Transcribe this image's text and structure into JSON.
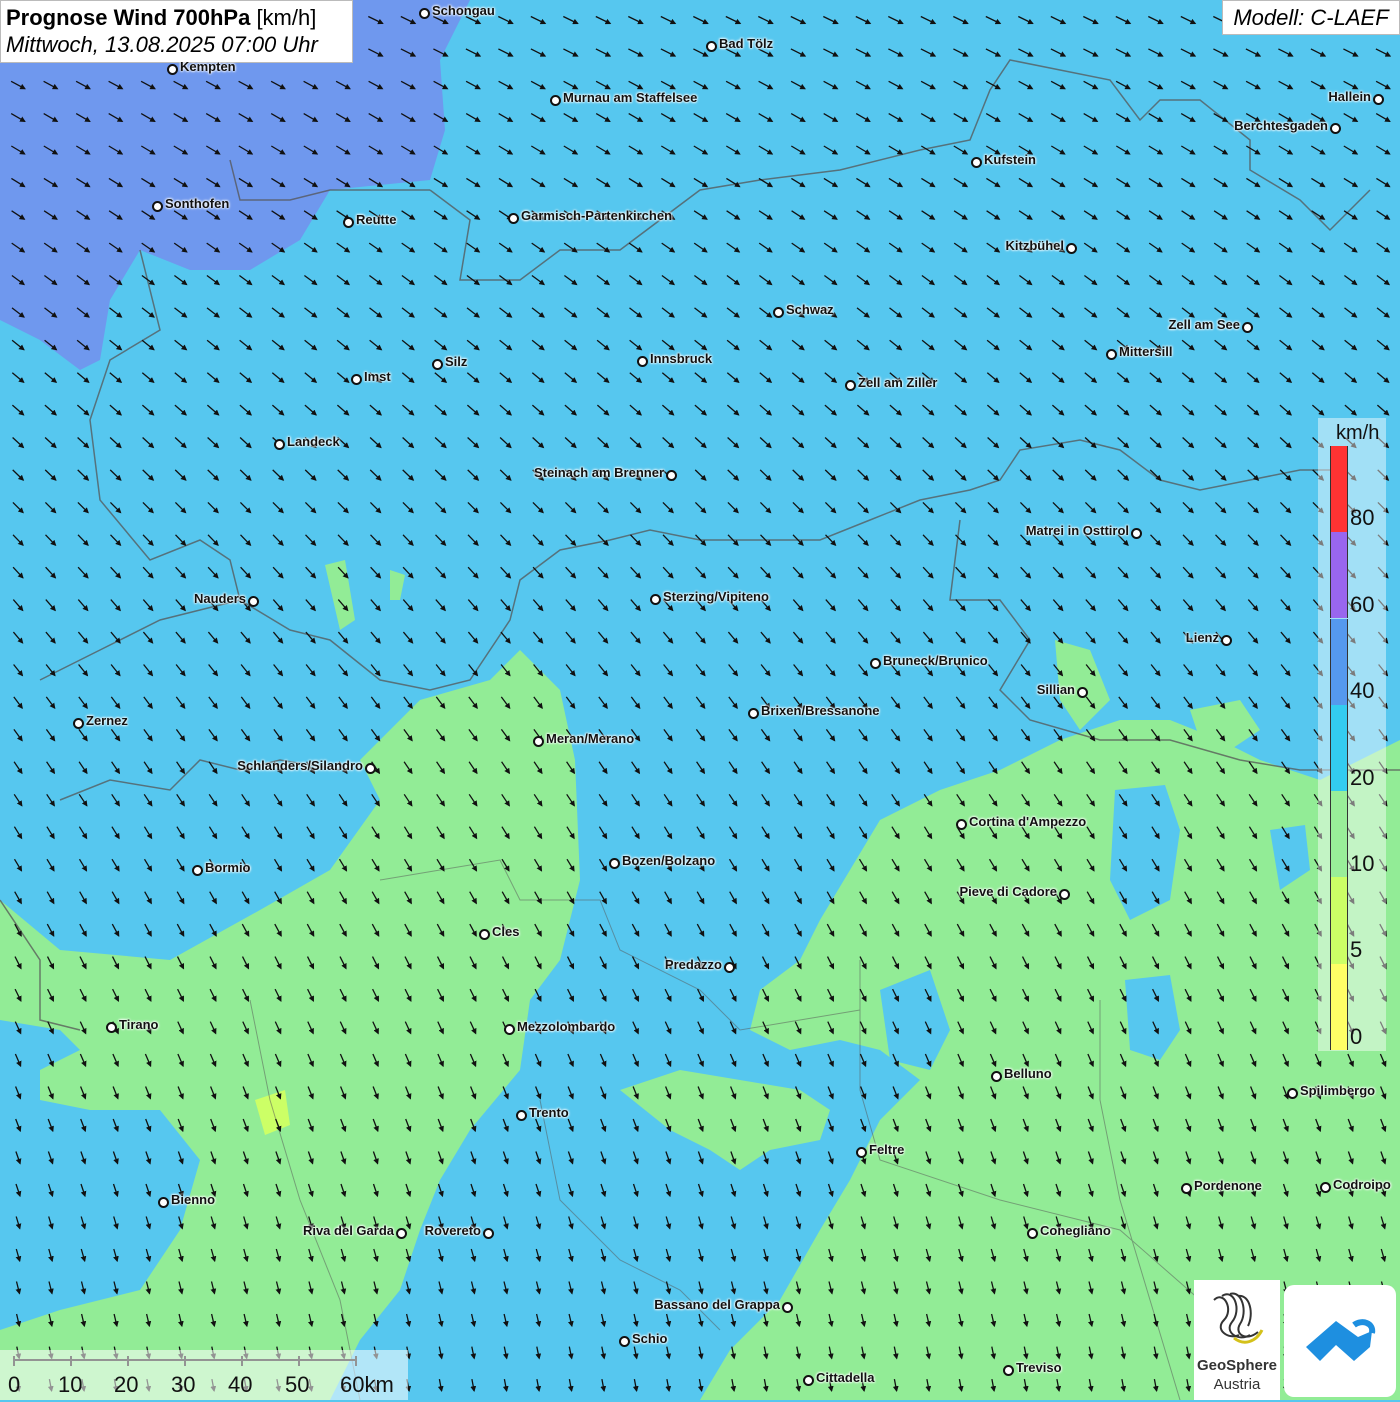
{
  "header": {
    "title_bold": "Prognose Wind 700hPa",
    "title_unit": "[km/h]",
    "datetime": "Mittwoch, 13.08.2025 07:00 Uhr"
  },
  "model_label": "Modell: C-LAEF",
  "legend": {
    "unit": "km/h",
    "ticks": [
      "0",
      "5",
      "10",
      "20",
      "40",
      "60",
      "80"
    ],
    "colors": [
      "#ffff66",
      "#ccff66",
      "#99ee99",
      "#33ccf0",
      "#5599ee",
      "#9966ee",
      "#ff3333"
    ]
  },
  "scale_bar": {
    "labels": [
      "0",
      "10",
      "20",
      "30",
      "40",
      "50",
      "60km"
    ]
  },
  "logos": {
    "geosphere_line1": "GeoSphere",
    "geosphere_line2": "Austria"
  },
  "cities": [
    {
      "name": "Schongau",
      "label_side": "right"
    },
    {
      "name": "Bad Tölz",
      "label_side": "right"
    },
    {
      "name": "Kempten",
      "label_side": "right"
    },
    {
      "name": "Murnau am Staffelsee",
      "label_side": "right"
    },
    {
      "name": "Hallein",
      "label_side": "left"
    },
    {
      "name": "Berchtesgaden",
      "label_side": "left"
    },
    {
      "name": "Kufstein",
      "label_side": "right"
    },
    {
      "name": "Sonthofen",
      "label_side": "right"
    },
    {
      "name": "Reutte",
      "label_side": "right"
    },
    {
      "name": "Garmisch-Partenkirchen",
      "label_side": "right"
    },
    {
      "name": "Kitzbühel",
      "label_side": "left"
    },
    {
      "name": "Schwaz",
      "label_side": "right"
    },
    {
      "name": "Zell am See",
      "label_side": "left"
    },
    {
      "name": "Mittersill",
      "label_side": "right"
    },
    {
      "name": "Innsbruck",
      "label_side": "right"
    },
    {
      "name": "Silz",
      "label_side": "right"
    },
    {
      "name": "Imst",
      "label_side": "right"
    },
    {
      "name": "Zell am Ziller",
      "label_side": "right"
    },
    {
      "name": "Landeck",
      "label_side": "right"
    },
    {
      "name": "Steinach am Brenner",
      "label_side": "left"
    },
    {
      "name": "Matrei in Osttirol",
      "label_side": "left"
    },
    {
      "name": "Nauders",
      "label_side": "left"
    },
    {
      "name": "Sterzing/Vipiteno",
      "label_side": "right"
    },
    {
      "name": "Lienz",
      "label_side": "left"
    },
    {
      "name": "Bruneck/Brunico",
      "label_side": "right"
    },
    {
      "name": "Sillian",
      "label_side": "left"
    },
    {
      "name": "Brixen/Bressanone",
      "label_side": "right"
    },
    {
      "name": "Zernez",
      "label_side": "right"
    },
    {
      "name": "Meran/Merano",
      "label_side": "right"
    },
    {
      "name": "Schlanders/Silandro",
      "label_side": "left"
    },
    {
      "name": "Cortina d'Ampezzo",
      "label_side": "right"
    },
    {
      "name": "Bozen/Bolzano",
      "label_side": "right"
    },
    {
      "name": "Bormio",
      "label_side": "right"
    },
    {
      "name": "Pieve di Cadore",
      "label_side": "left"
    },
    {
      "name": "Cles",
      "label_side": "right"
    },
    {
      "name": "Predazzo",
      "label_side": "left"
    },
    {
      "name": "Tirano",
      "label_side": "right"
    },
    {
      "name": "Mezzolombardo",
      "label_side": "right"
    },
    {
      "name": "Belluno",
      "label_side": "right"
    },
    {
      "name": "Spilimbergo",
      "label_side": "right"
    },
    {
      "name": "Trento",
      "label_side": "right"
    },
    {
      "name": "Feltre",
      "label_side": "right"
    },
    {
      "name": "Pordenone",
      "label_side": "right"
    },
    {
      "name": "Codroipo",
      "label_side": "right"
    },
    {
      "name": "Bienno",
      "label_side": "right"
    },
    {
      "name": "Riva del Garda",
      "label_side": "left"
    },
    {
      "name": "Rovereto",
      "label_side": "left"
    },
    {
      "name": "Conegliano",
      "label_side": "right"
    },
    {
      "name": "Bassano del Grappa",
      "label_side": "left"
    },
    {
      "name": "Schio",
      "label_side": "right"
    },
    {
      "name": "Treviso",
      "label_side": "right"
    },
    {
      "name": "Cittadella",
      "label_side": "right"
    }
  ]
}
